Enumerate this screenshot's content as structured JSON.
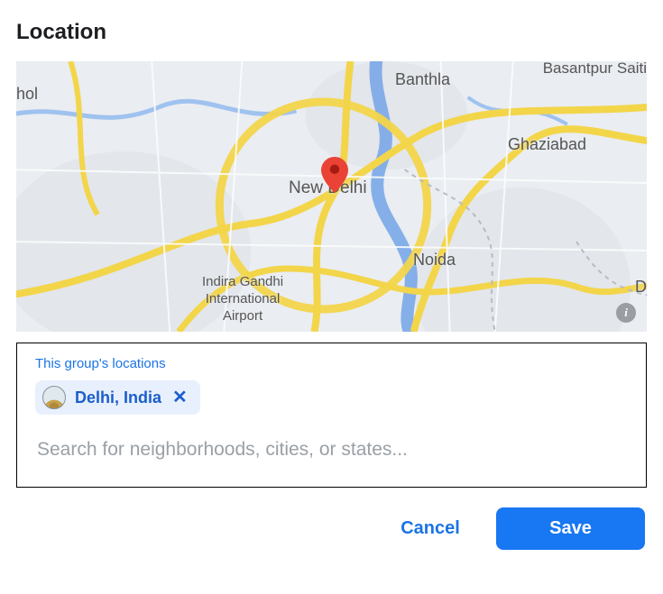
{
  "title": "Location",
  "map": {
    "center_label": "New Delhi",
    "labels": {
      "banthla": "Banthla",
      "basantpur": "Basantpur Saiti",
      "ghaziabad": "Ghaziabad",
      "noida": "Noida",
      "hol": "hol",
      "d": "D",
      "airport_l1": "Indira Gandhi",
      "airport_l2": "International",
      "airport_l3": "Airport"
    },
    "pin_color": "#ea4335",
    "info_glyph": "i"
  },
  "panel": {
    "heading": "This group's locations",
    "chips": [
      {
        "label": "Delhi, India"
      }
    ],
    "search_placeholder": "Search for neighborhoods, cities, or states...",
    "search_value": ""
  },
  "footer": {
    "cancel": "Cancel",
    "save": "Save"
  },
  "colors": {
    "link": "#1b74e4",
    "primary": "#1877f2",
    "chip_bg": "#e8f0fd",
    "chip_fg": "#1b5ecc"
  }
}
